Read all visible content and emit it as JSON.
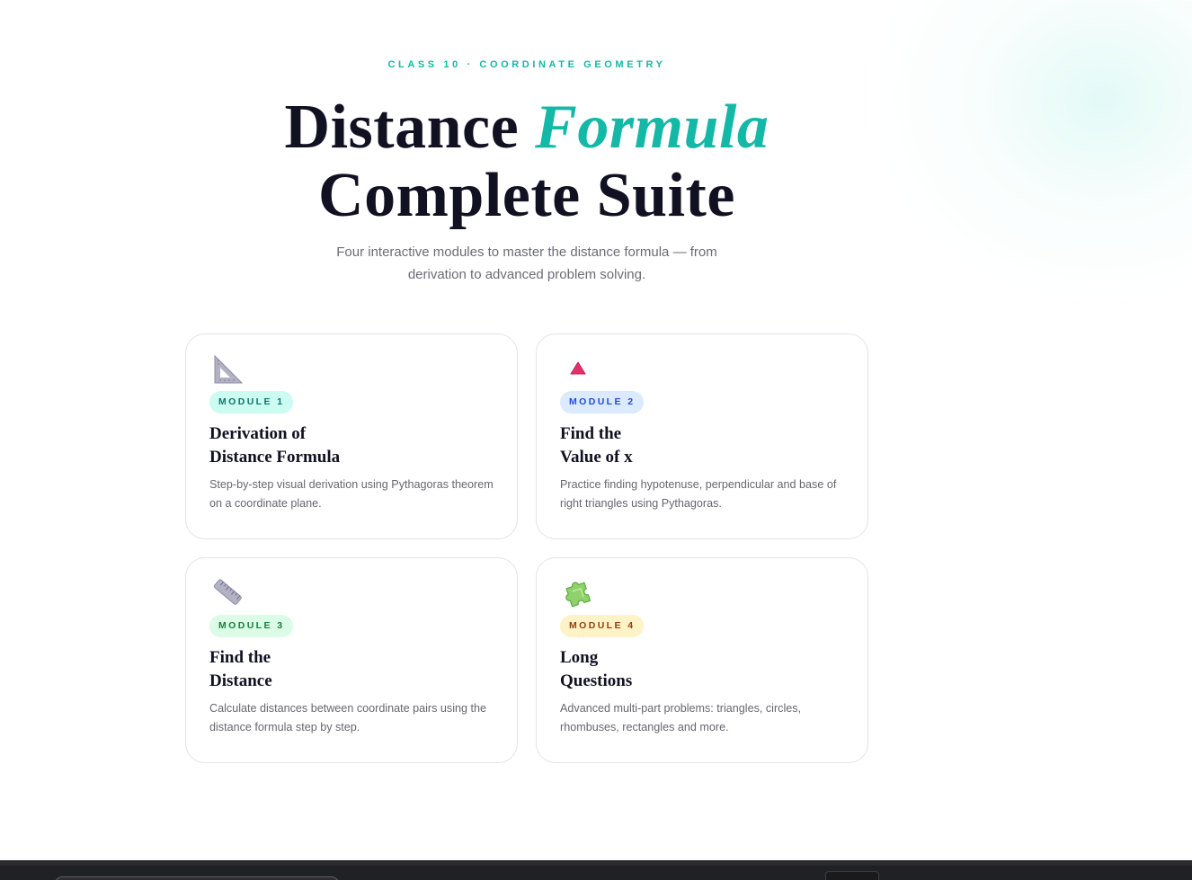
{
  "hero": {
    "eyebrow": "CLASS 10 · COORDINATE GEOMETRY",
    "title_line1": "Distance",
    "title_accent": "Formula",
    "title_line2": "Complete Suite",
    "subtitle": "Four interactive modules to master the distance formula — from derivation to advanced problem solving."
  },
  "modules": [
    {
      "icon": "set-square-icon",
      "badge": "MODULE 1",
      "title_line1": "Derivation of",
      "title_line2": "Distance Formula",
      "description": "Step-by-step visual derivation using Pythagoras theorem on a coordinate plane.",
      "badge_bg": "#ccfbf1",
      "badge_color": "#0f766e"
    },
    {
      "icon": "red-triangle-icon",
      "badge": "MODULE 2",
      "title_line1": "Find the",
      "title_line2": "Value of x",
      "description": "Practice finding hypotenuse, perpendicular and base of right triangles using Pythagoras.",
      "badge_bg": "#dbeafe",
      "badge_color": "#1d4ed8"
    },
    {
      "icon": "ruler-icon",
      "badge": "MODULE 3",
      "title_line1": "Find the",
      "title_line2": "Distance",
      "description": "Calculate distances between coordinate pairs using the distance formula step by step.",
      "badge_bg": "#dcfce7",
      "badge_color": "#15803d"
    },
    {
      "icon": "puzzle-piece-icon",
      "badge": "MODULE 4",
      "title_line1": "Long",
      "title_line2": "Questions",
      "description": "Advanced multi-part problems: triangles, circles, rhombuses, rectangles and more.",
      "badge_bg": "#fef3c7",
      "badge_color": "#92400e"
    }
  ],
  "colors": {
    "accent": "#14b8a6",
    "heading": "#111122",
    "muted": "#6b6b76"
  }
}
